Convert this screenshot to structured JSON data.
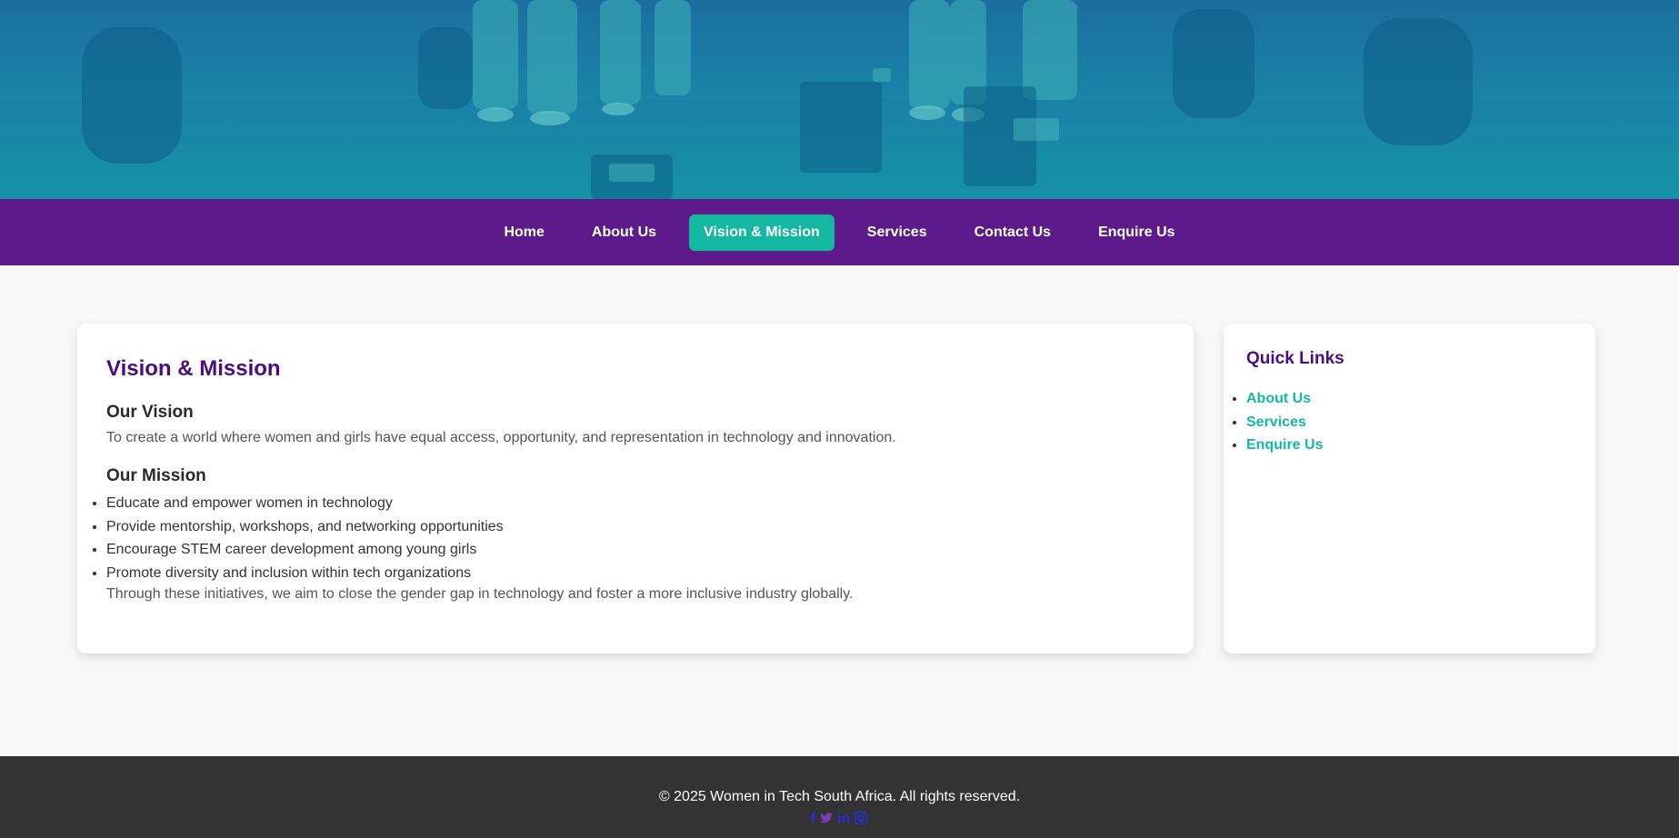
{
  "nav": {
    "items": [
      {
        "label": "Home",
        "active": false
      },
      {
        "label": "About Us",
        "active": false
      },
      {
        "label": "Vision & Mission",
        "active": true
      },
      {
        "label": "Services",
        "active": false
      },
      {
        "label": "Contact Us",
        "active": false
      },
      {
        "label": "Enquire Us",
        "active": false
      }
    ]
  },
  "main": {
    "title": "Vision & Mission",
    "vision_heading": "Our Vision",
    "vision_text": "To create a world where women and girls have equal access, opportunity, and representation in technology and innovation.",
    "mission_heading": "Our Mission",
    "mission_items": [
      "Educate and empower women in technology",
      "Provide mentorship, workshops, and networking opportunities",
      "Encourage STEM career development among young girls",
      "Promote diversity and inclusion within tech organizations"
    ],
    "closing_text": "Through these initiatives, we aim to close the gender gap in technology and foster a more inclusive industry globally."
  },
  "sidebar": {
    "title": "Quick Links",
    "links": [
      "About Us",
      "Services",
      "Enquire Us"
    ]
  },
  "footer": {
    "copyright": "© 2025 Women in Tech South Africa. All rights reserved.",
    "social_icons": [
      "facebook-icon",
      "twitter-icon",
      "linkedin-icon",
      "instagram-icon"
    ]
  },
  "colors": {
    "nav_bg": "#5c1a8a",
    "accent": "#14b8a0",
    "heading": "#4b0f7d",
    "footer_bg": "#333333"
  }
}
